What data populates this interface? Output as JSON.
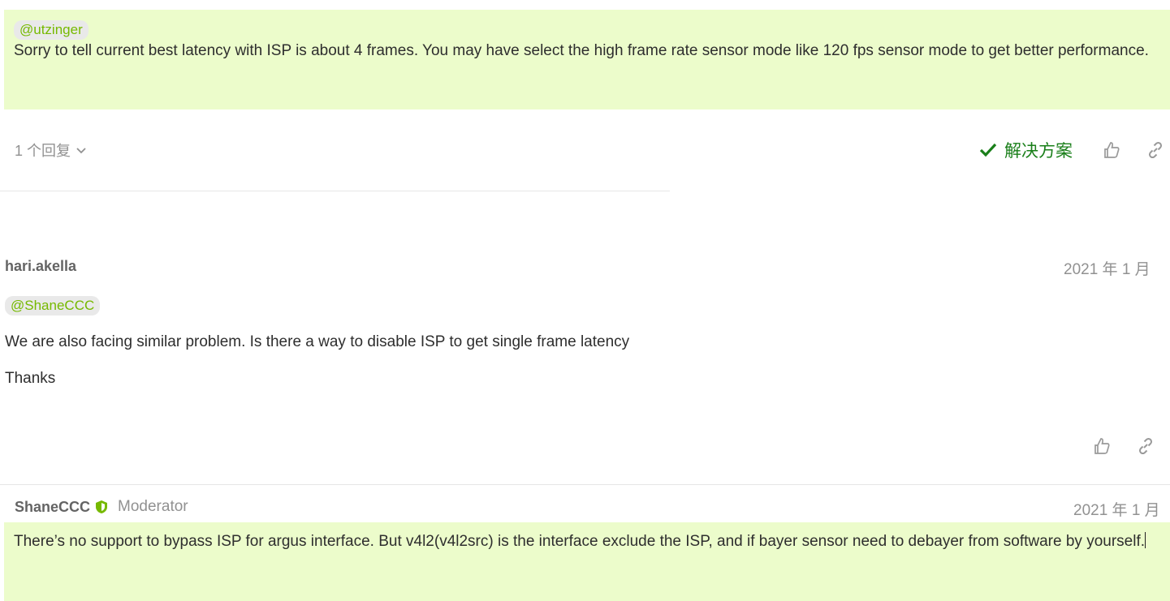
{
  "post1": {
    "mention": "@utzinger",
    "text": "Sorry to tell current best latency with ISP is about 4 frames. You may have select the high frame rate sensor mode like 120 fps sensor mode to get better performance.",
    "replies_label": "1 个回复",
    "solution_label": "解决方案"
  },
  "post2": {
    "username": "hari.akella",
    "date": "2021 年 1 月",
    "mention": "@ShaneCCC",
    "text1": "We are also facing similar problem. Is there a way to disable ISP to get single frame latency",
    "text2": "Thanks"
  },
  "post3": {
    "username": "ShaneCCC",
    "role": "Moderator",
    "date": "2021 年 1 月",
    "text": "There’s no support to bypass ISP for argus interface. But v4l2(v4l2src) is the interface exclude the ISP, and if bayer sensor need to debayer from software by yourself."
  },
  "colors": {
    "accent": "#76b900",
    "solution_green": "#1a7f1a",
    "post_bg": "#ecfccb",
    "meta_gray": "#919191"
  },
  "icons": [
    "check-icon",
    "like-icon",
    "link-icon",
    "chevron-down-icon",
    "shield-icon"
  ]
}
